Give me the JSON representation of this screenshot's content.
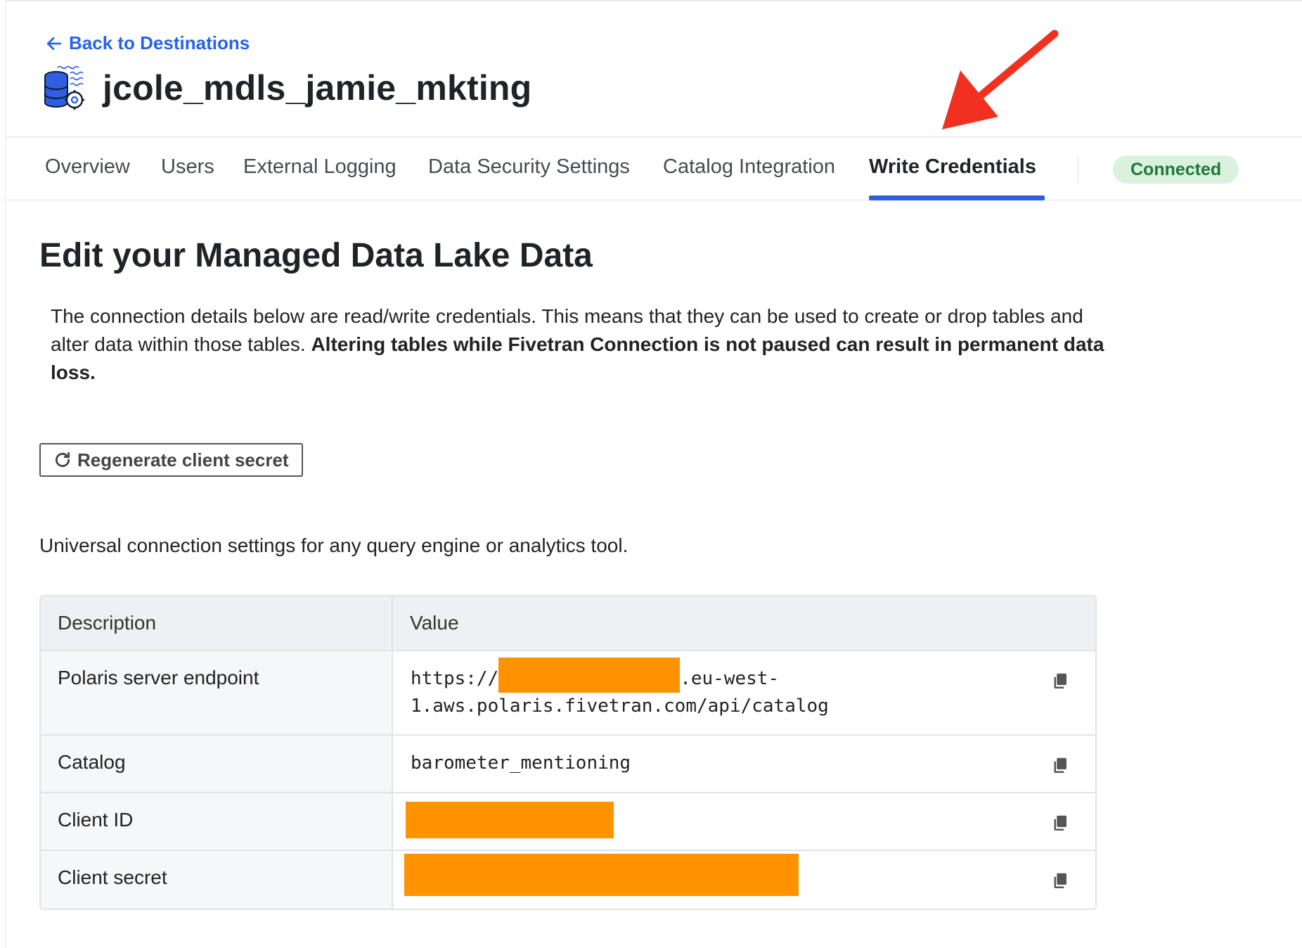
{
  "header": {
    "back_link": "Back to Destinations",
    "destination_name": "jcole_mdls_jamie_mkting",
    "destination_icon": "data-lake-database-icon"
  },
  "tabs": [
    {
      "label": "Overview",
      "active": false
    },
    {
      "label": "Users",
      "active": false
    },
    {
      "label": "External Logging",
      "active": false
    },
    {
      "label": "Data Security Settings",
      "active": false
    },
    {
      "label": "Catalog Integration",
      "active": false
    },
    {
      "label": "Write Credentials",
      "active": true
    }
  ],
  "status": {
    "label": "Connected",
    "color": "#1f7a35",
    "background": "#d9f1dd"
  },
  "accent_color": "#2f5fe0",
  "link_color": "#2563eb",
  "annotation": {
    "arrow_color": "#f2301f"
  },
  "main": {
    "title": "Edit your Managed Data Lake Data",
    "intro_plain": "The connection details below are read/write credentials. This means that they can be used to create or drop tables and alter data within those tables.",
    "intro_bold": "Altering tables while Fivetran Connection is not paused can result in permanent data loss.",
    "regenerate_button": "Regenerate client secret",
    "universal_text": "Universal connection settings for any query engine or analytics tool."
  },
  "table": {
    "headers": {
      "description": "Description",
      "value": "Value"
    },
    "rows": [
      {
        "description": "Polaris server endpoint",
        "value_prefix": "https://",
        "value_suffix": ".eu-west-1.aws.polaris.fivetran.com/api/catalog",
        "redacted": true
      },
      {
        "description": "Catalog",
        "value": "barometer_mentioning",
        "redacted": false
      },
      {
        "description": "Client ID",
        "value": "",
        "redacted": true
      },
      {
        "description": "Client secret",
        "value": "",
        "redacted": true
      }
    ],
    "copy_icon": "copy-icon",
    "redaction_color": "#ff9200"
  }
}
